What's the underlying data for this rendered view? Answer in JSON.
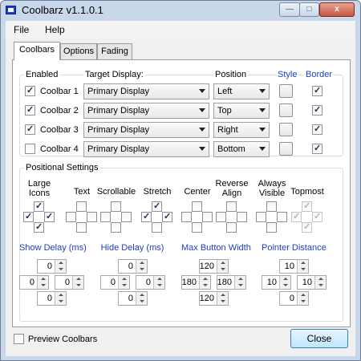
{
  "window": {
    "title": "Coolbarz v1.1.0.1",
    "minimize": "—",
    "maximize": "□",
    "close": "x"
  },
  "menu": [
    "File",
    "Help"
  ],
  "tabs": [
    "Coolbars",
    "Options",
    "Fading"
  ],
  "coolbars": {
    "headers": {
      "enabled": "Enabled",
      "target": "Target Display:",
      "position": "Position",
      "style": "Style",
      "border": "Border"
    },
    "rows": [
      {
        "label": "Coolbar 1",
        "enabled": true,
        "display": "Primary Display",
        "position": "Left",
        "border": true
      },
      {
        "label": "Coolbar 2",
        "enabled": true,
        "display": "Primary Display",
        "position": "Top",
        "border": true
      },
      {
        "label": "Coolbar 3",
        "enabled": true,
        "display": "Primary Display",
        "position": "Right",
        "border": true
      },
      {
        "label": "Coolbar 4",
        "enabled": false,
        "display": "Primary Display",
        "position": "Bottom",
        "border": true
      }
    ]
  },
  "positional": {
    "title": "Positional Settings",
    "columns": [
      {
        "label": "Large\nIcons",
        "checks": [
          true,
          true,
          true,
          true
        ],
        "disabled": false
      },
      {
        "label": "Text",
        "checks": [
          false,
          false,
          false,
          false
        ],
        "disabled": false
      },
      {
        "label": "Scrollable",
        "checks": [
          false,
          false,
          false,
          false
        ],
        "disabled": false
      },
      {
        "label": "Stretch",
        "checks": [
          true,
          true,
          true,
          false
        ],
        "disabled": false
      },
      {
        "label": "Center",
        "checks": [
          false,
          false,
          false,
          false
        ],
        "disabled": false
      },
      {
        "label": "Reverse\nAlign",
        "checks": [
          false,
          false,
          false,
          false
        ],
        "disabled": false
      },
      {
        "label": "Always\nVisible",
        "checks": [
          false,
          false,
          false,
          false
        ],
        "disabled": false
      },
      {
        "label": "Topmost",
        "checks": [
          true,
          true,
          true,
          true
        ],
        "disabled": true
      }
    ],
    "spinners": [
      {
        "label": "Show Delay (ms)",
        "top": "0",
        "left": "0",
        "right": "0",
        "bottom": "0"
      },
      {
        "label": "Hide Delay (ms)",
        "top": "0",
        "left": "0",
        "right": "0",
        "bottom": "0"
      },
      {
        "label": "Max Button Width",
        "top": "120",
        "left": "180",
        "right": "180",
        "bottom": "120"
      },
      {
        "label": "Pointer Distance",
        "top": "10",
        "left": "10",
        "right": "10",
        "bottom": "0"
      }
    ]
  },
  "footer": {
    "preview": "Preview Coolbars",
    "preview_checked": false,
    "close": "Close"
  }
}
